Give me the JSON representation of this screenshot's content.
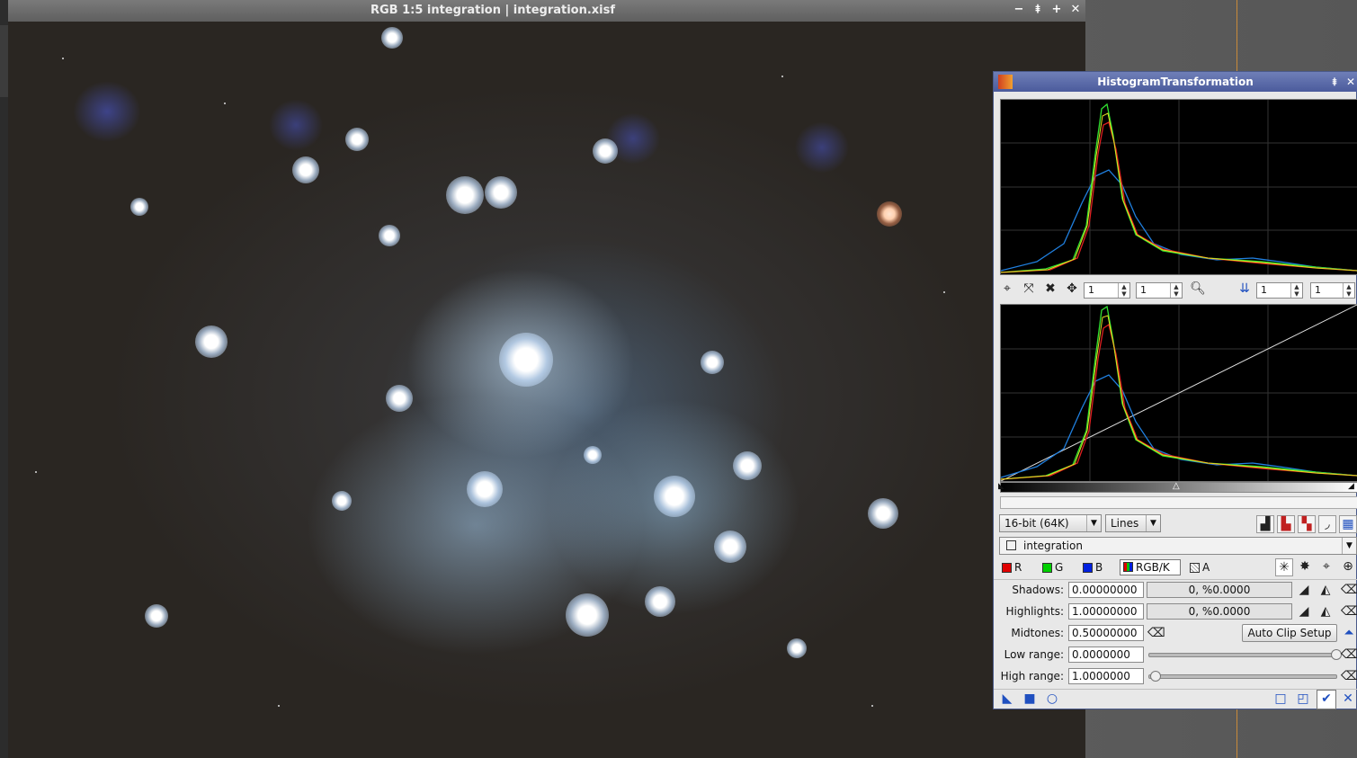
{
  "image_window": {
    "title": "RGB 1:5 integration | integration.xisf",
    "buttons": {
      "minimize": "−",
      "shade": "⯒",
      "maximize": "+",
      "close": "✕"
    }
  },
  "histogram_panel": {
    "title": "HistogramTransformation",
    "zoom_controls": {
      "h_zoom": "1",
      "v_zoom": "1",
      "h_zoom2": "1",
      "v_zoom2": "1"
    },
    "resolution": "16-bit (64K)",
    "graph_style": "Lines",
    "view": "integration",
    "channels": [
      {
        "label": "R",
        "color": "#e00000"
      },
      {
        "label": "G",
        "color": "#00d000"
      },
      {
        "label": "B",
        "color": "#0020e0"
      },
      {
        "label": "RGB/K",
        "color": "#888888"
      },
      {
        "label": "A",
        "color": "#ffffff"
      }
    ],
    "shadows": {
      "label": "Shadows:",
      "value": "0.00000000",
      "clip": "0, %0.0000"
    },
    "highlights": {
      "label": "Highlights:",
      "value": "1.00000000",
      "clip": "0, %0.0000"
    },
    "midtones": {
      "label": "Midtones:",
      "value": "0.50000000"
    },
    "auto_clip_label": "Auto Clip Setup",
    "low_range": {
      "label": "Low range:",
      "value": "0.0000000",
      "slider": 1.0
    },
    "high_range": {
      "label": "High range:",
      "value": "1.0000000",
      "slider": 0.0
    }
  },
  "colors": {
    "red_curve": "#e02020",
    "green_curve": "#30e030",
    "blue_curve": "#2080e0",
    "yellow_curve": "#e0e020",
    "titlebar": "#5060a8"
  }
}
